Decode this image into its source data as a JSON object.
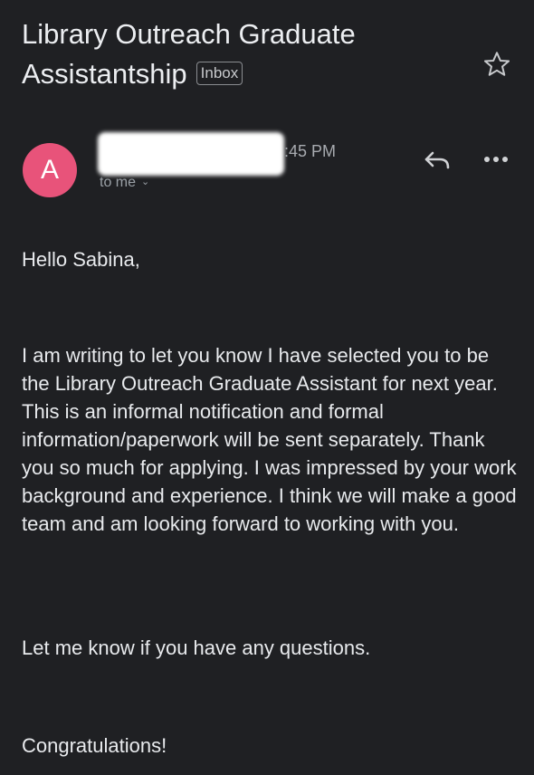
{
  "email": {
    "subject": "Library Outreach Graduate Assistantship",
    "label": "Inbox",
    "sender_initial": "A",
    "time": ":45 PM",
    "recipient": "to me",
    "body": {
      "greeting": "Hello Sabina,",
      "paragraph1": "I am writing to let you know I have selected you to be the Library Outreach Graduate Assistant for next year.  This is an informal notification and formal information/paperwork will be sent separately.  Thank you so much for applying.  I was impressed by your work background and experience.   I think we will make a good team and am looking forward to working with you.",
      "paragraph2": "Let me know if you have any questions.",
      "closing": "Congratulations!"
    }
  },
  "icons": {
    "star": "star-icon",
    "reply": "reply-icon",
    "more": "more-horizontal-icon",
    "chevron": "chevron-down-icon"
  },
  "colors": {
    "background": "#1f2023",
    "avatar": "#e8537a",
    "text": "#e8eaed",
    "secondary_text": "#9aa0a6"
  }
}
